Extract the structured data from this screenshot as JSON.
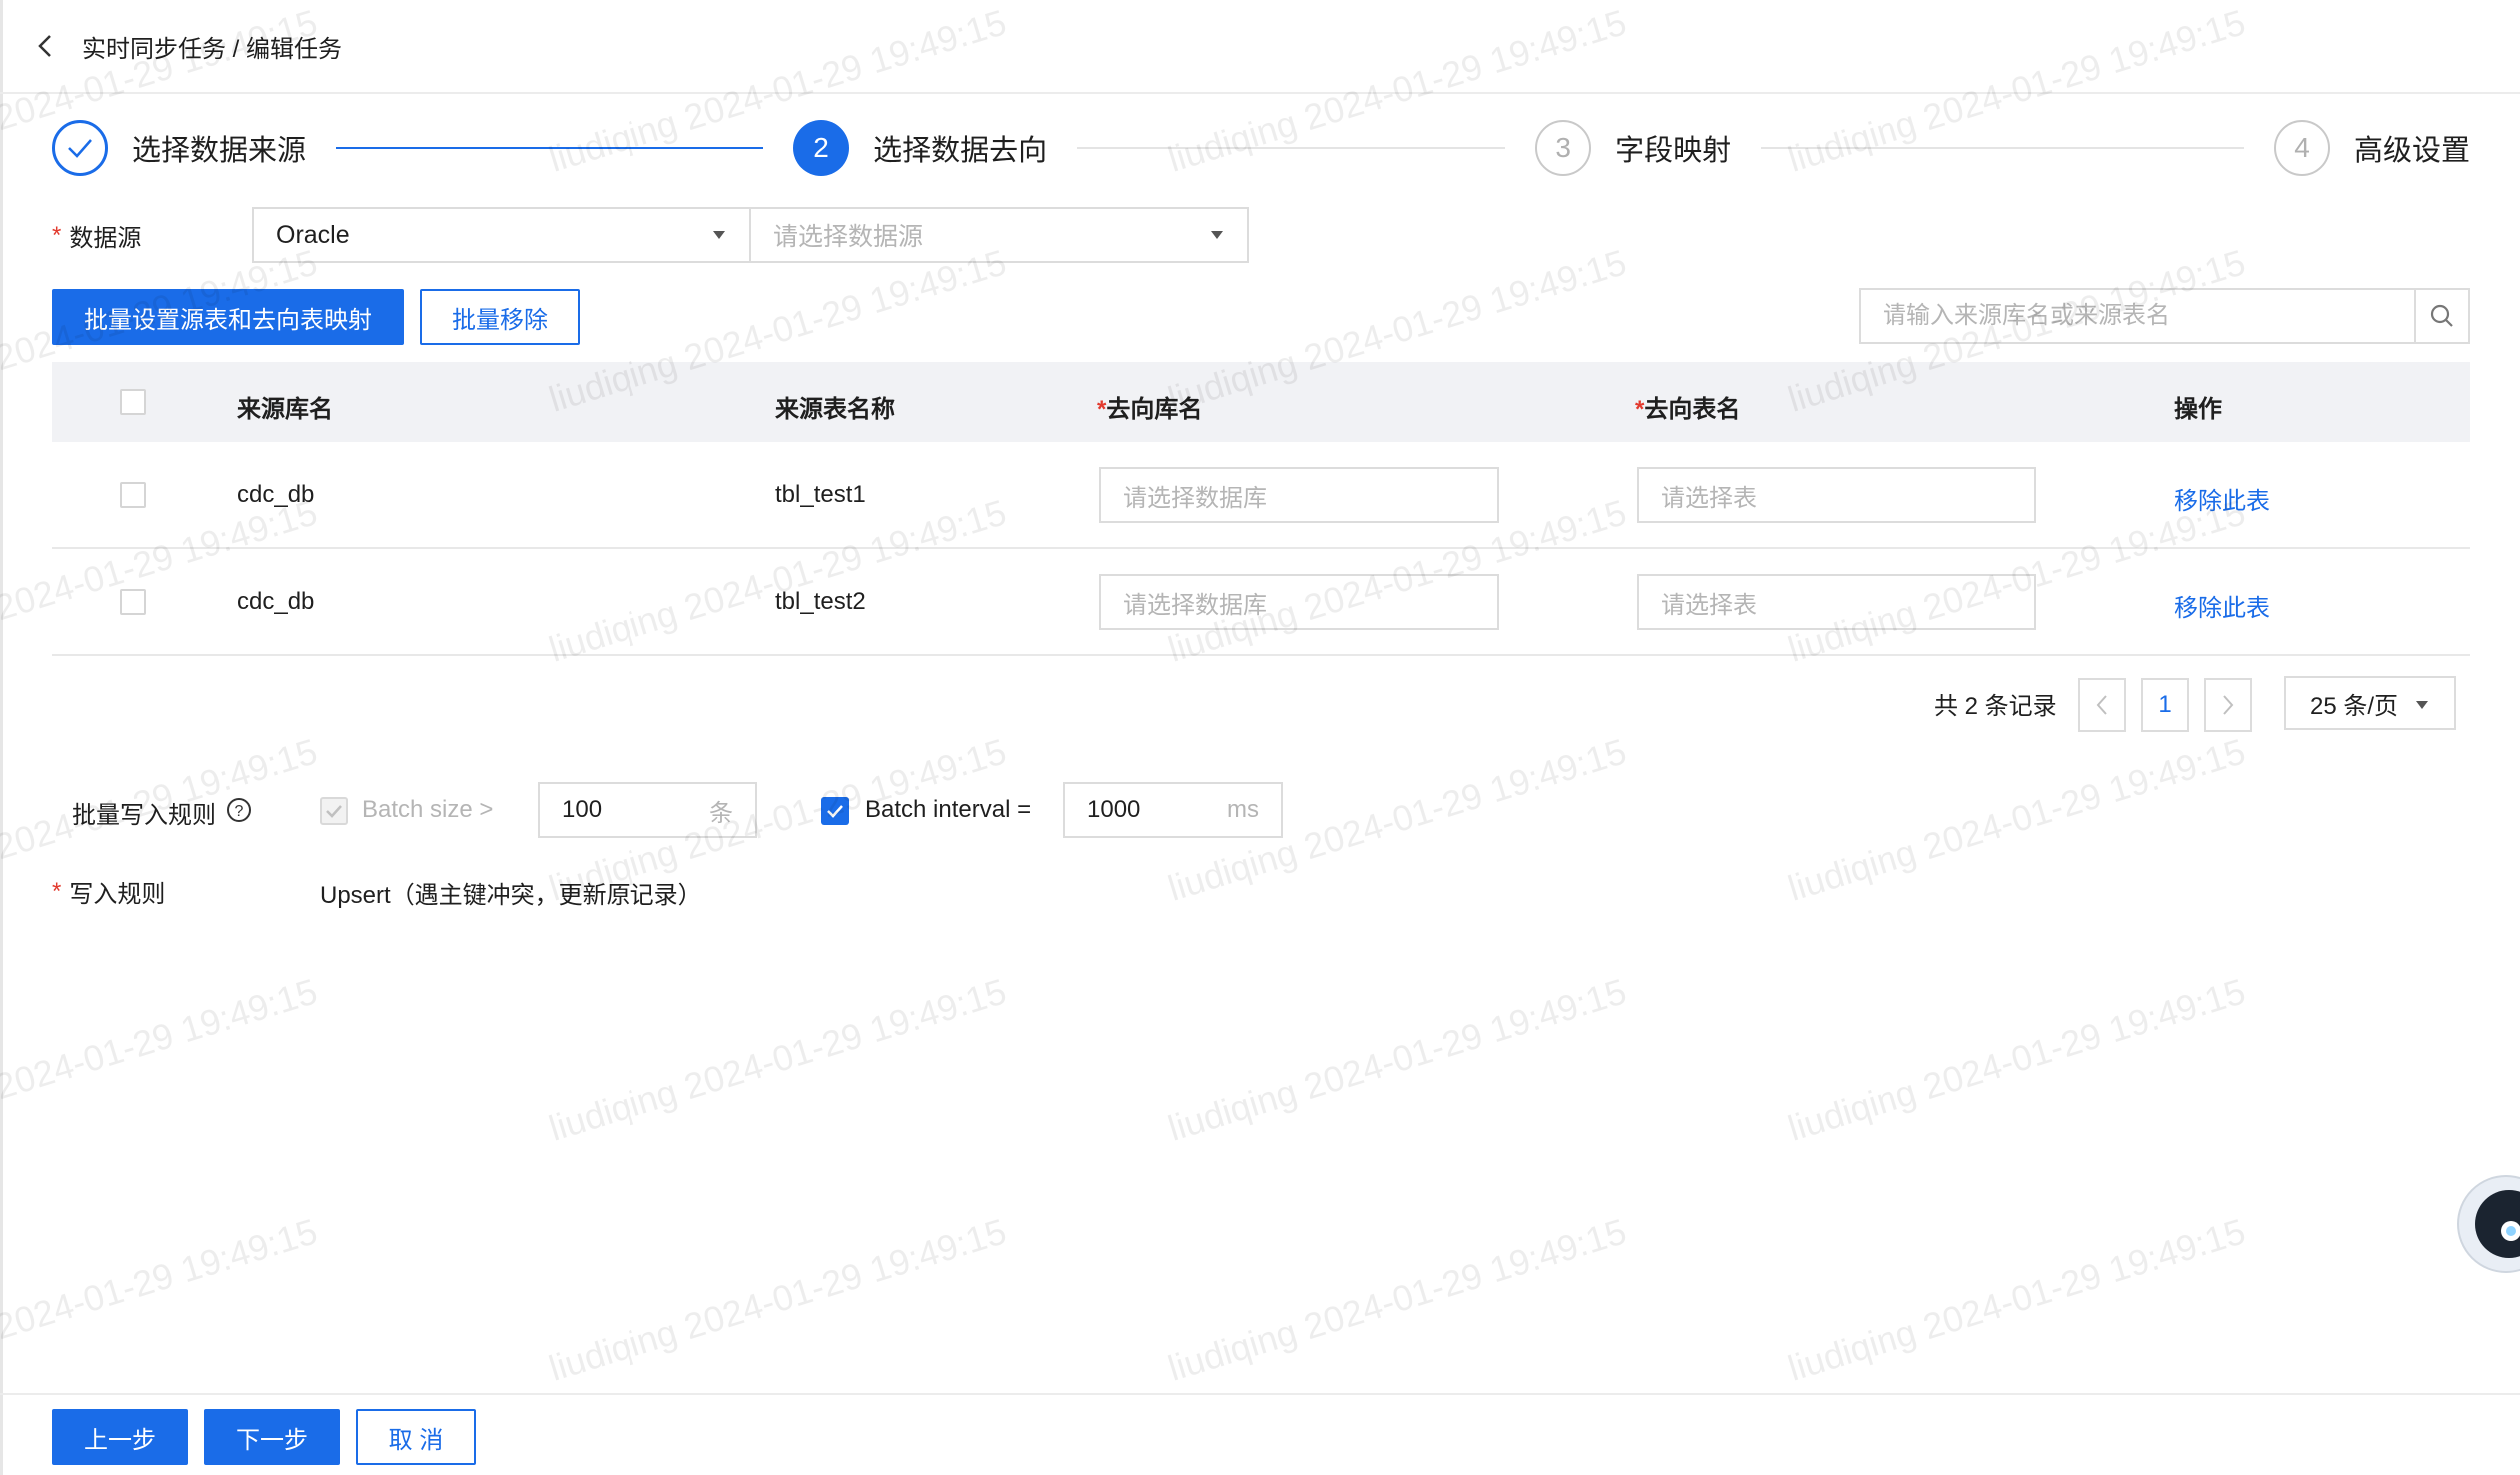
{
  "header": {
    "breadcrumb": "实时同步任务 / 编辑任务"
  },
  "steps": [
    {
      "index": "✓",
      "label": "选择数据来源",
      "state": "done"
    },
    {
      "index": "2",
      "label": "选择数据去向",
      "state": "active"
    },
    {
      "index": "3",
      "label": "字段映射",
      "state": "wait"
    },
    {
      "index": "4",
      "label": "高级设置",
      "state": "wait"
    }
  ],
  "datasource": {
    "label": "数据源",
    "type_value": "Oracle",
    "source_placeholder": "请选择数据源"
  },
  "toolbar": {
    "batch_map_label": "批量设置源表和去向表映射",
    "batch_remove_label": "批量移除",
    "search_placeholder": "请输入来源库名或来源表名"
  },
  "table": {
    "columns": {
      "source_db": "来源库名",
      "source_table": "来源表名称",
      "target_db": "去向库名",
      "target_table": "去向表名",
      "action": "操作"
    },
    "rows": [
      {
        "source_db": "cdc_db",
        "source_table": "tbl_test1",
        "target_db_placeholder": "请选择数据库",
        "target_table_placeholder": "请选择表",
        "action": "移除此表"
      },
      {
        "source_db": "cdc_db",
        "source_table": "tbl_test2",
        "target_db_placeholder": "请选择数据库",
        "target_table_placeholder": "请选择表",
        "action": "移除此表"
      }
    ]
  },
  "pagination": {
    "total_text": "共 2 条记录",
    "current_page": "1",
    "page_size": "25 条/页"
  },
  "batch_rules": {
    "label": "批量写入规则",
    "batch_size_label": "Batch size >",
    "batch_size_value": "100",
    "batch_size_unit": "条",
    "batch_interval_label": "Batch interval =",
    "batch_interval_value": "1000",
    "batch_interval_unit": "ms"
  },
  "write_rule": {
    "label": "写入规则",
    "value": "Upsert（遇主键冲突，更新原记录）"
  },
  "footer": {
    "prev_label": "上一步",
    "next_label": "下一步",
    "cancel_label": "取 消"
  },
  "watermark": "liudiqing 2024-01-29 19:49:15",
  "colors": {
    "primary": "#1a6ce8",
    "required": "#e23a2e",
    "header_bg": "#f1f2f5"
  }
}
